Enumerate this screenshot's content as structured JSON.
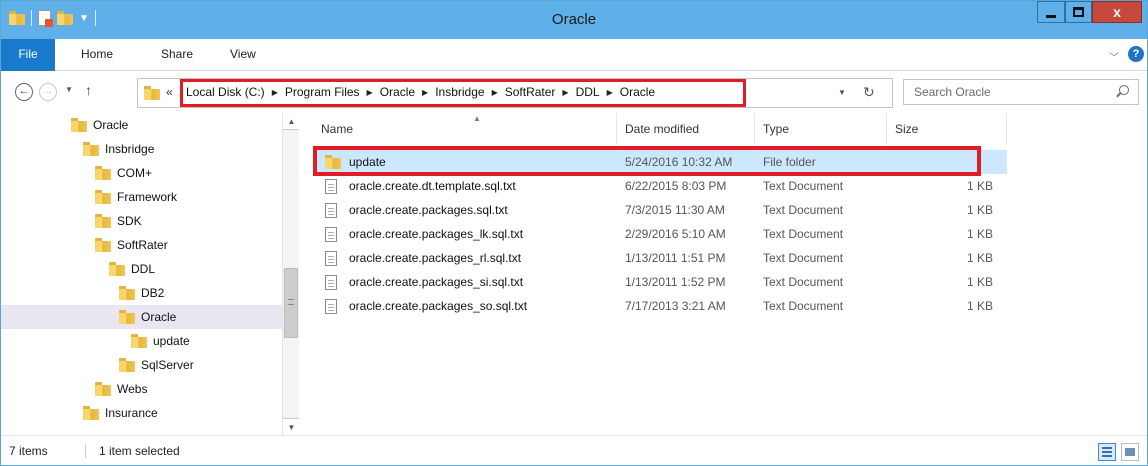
{
  "window": {
    "title": "Oracle",
    "close_label": "x"
  },
  "ribbon": {
    "tabs": [
      "File",
      "Home",
      "Share",
      "View"
    ],
    "help_label": "?"
  },
  "address": {
    "overflow": "«",
    "crumbs": [
      "Local Disk (C:)",
      "Program Files",
      "Oracle",
      "Insbridge",
      "SoftRater",
      "DDL",
      "Oracle"
    ]
  },
  "search": {
    "placeholder": "Search Oracle"
  },
  "tree": [
    {
      "label": "Oracle",
      "level": 0,
      "selected": false
    },
    {
      "label": "Insbridge",
      "level": 1,
      "selected": false
    },
    {
      "label": "COM+",
      "level": 2,
      "selected": false
    },
    {
      "label": "Framework",
      "level": 2,
      "selected": false
    },
    {
      "label": "SDK",
      "level": 2,
      "selected": false
    },
    {
      "label": "SoftRater",
      "level": 2,
      "selected": false
    },
    {
      "label": "DDL",
      "level": 3,
      "selected": false
    },
    {
      "label": "DB2",
      "level": 4,
      "selected": false
    },
    {
      "label": "Oracle",
      "level": 4,
      "selected": true
    },
    {
      "label": "update",
      "level": 5,
      "selected": false
    },
    {
      "label": "SqlServer",
      "level": 4,
      "selected": false
    },
    {
      "label": "Webs",
      "level": 2,
      "selected": false
    },
    {
      "label": "Insurance",
      "level": 1,
      "selected": false
    }
  ],
  "columns": {
    "name": "Name",
    "date": "Date modified",
    "type": "Type",
    "size": "Size"
  },
  "files": [
    {
      "name": "update",
      "date": "5/24/2016 10:32 AM",
      "type": "File folder",
      "size": "",
      "icon": "folder-icon",
      "selected": true
    },
    {
      "name": "oracle.create.dt.template.sql.txt",
      "date": "6/22/2015 8:03 PM",
      "type": "Text Document",
      "size": "1 KB",
      "icon": "text-file-icon",
      "selected": false
    },
    {
      "name": "oracle.create.packages.sql.txt",
      "date": "7/3/2015 11:30 AM",
      "type": "Text Document",
      "size": "1 KB",
      "icon": "text-file-icon",
      "selected": false
    },
    {
      "name": "oracle.create.packages_lk.sql.txt",
      "date": "2/29/2016 5:10 AM",
      "type": "Text Document",
      "size": "1 KB",
      "icon": "text-file-icon",
      "selected": false
    },
    {
      "name": "oracle.create.packages_rl.sql.txt",
      "date": "1/13/2011 1:51 PM",
      "type": "Text Document",
      "size": "1 KB",
      "icon": "text-file-icon",
      "selected": false
    },
    {
      "name": "oracle.create.packages_si.sql.txt",
      "date": "1/13/2011 1:52 PM",
      "type": "Text Document",
      "size": "1 KB",
      "icon": "text-file-icon",
      "selected": false
    },
    {
      "name": "oracle.create.packages_so.sql.txt",
      "date": "7/17/2013 3:21 AM",
      "type": "Text Document",
      "size": "1 KB",
      "icon": "text-file-icon",
      "selected": false
    }
  ],
  "status": {
    "item_count": "7 items",
    "selected": "1 item selected"
  },
  "colors": {
    "titlebar": "#5fb0e8",
    "file_tab": "#1979ca",
    "close_button": "#c7493b",
    "highlight_box": "#e01c24",
    "selected_row": "#cce8ff"
  }
}
